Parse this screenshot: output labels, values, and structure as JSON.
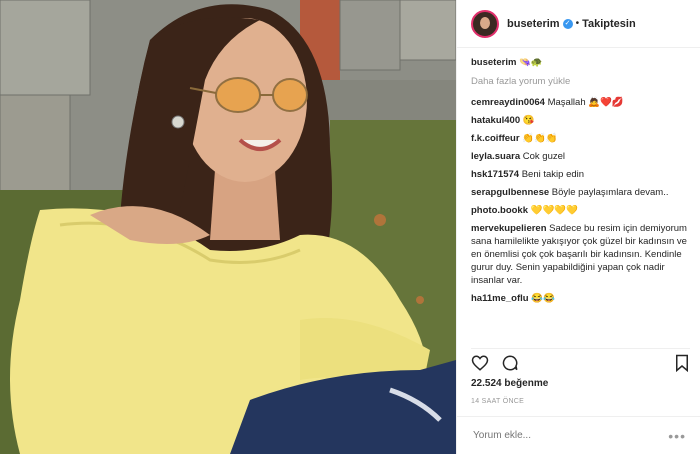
{
  "header": {
    "username": "buseterim",
    "verified_glyph": "✓",
    "separator": "•",
    "follow_label": "Takiptesin"
  },
  "caption": {
    "username": "buseterim",
    "emoji": "👒🐢"
  },
  "load_more": "Daha fazla yorum yükle",
  "comments": [
    {
      "user": "cemreaydin0064",
      "text": "Maşallah 🙇❤️💋"
    },
    {
      "user": "hatakul400",
      "text": "😘"
    },
    {
      "user": "f.k.coiffeur",
      "text": "👏👏👏"
    },
    {
      "user": "leyla.suara",
      "text": "Cok guzel"
    },
    {
      "user": "hsk171574",
      "text": "Beni takip edin"
    },
    {
      "user": "serapgulbennese",
      "text": "Böyle paylaşımlara devam.."
    },
    {
      "user": "photo.bookk",
      "text": "💛💛💛💛"
    },
    {
      "user": "mervekupelieren",
      "text": "Sadece bu resim için demiyorum sana hamilelikte yakışıyor çok güzel bir kadınsın ve en önemlisi çok çok başarılı bir kadınsın. Kendinle gurur duy. Senin yapabildiğini yapan çok nadir insanlar var."
    },
    {
      "user": "ha11me_oflu",
      "text": "😂😂"
    }
  ],
  "likes": "22.524 beğenme",
  "time": "14 SAAT ÖNCE",
  "comment_input": {
    "placeholder": "Yorum ekle..."
  },
  "more_glyph": "•••",
  "icons": [
    "heart-icon",
    "comment-icon",
    "bookmark-icon",
    "verified-icon",
    "options-icon"
  ],
  "colors": {
    "accent": "#3897f0",
    "muted": "#999999",
    "border": "#efefef"
  }
}
